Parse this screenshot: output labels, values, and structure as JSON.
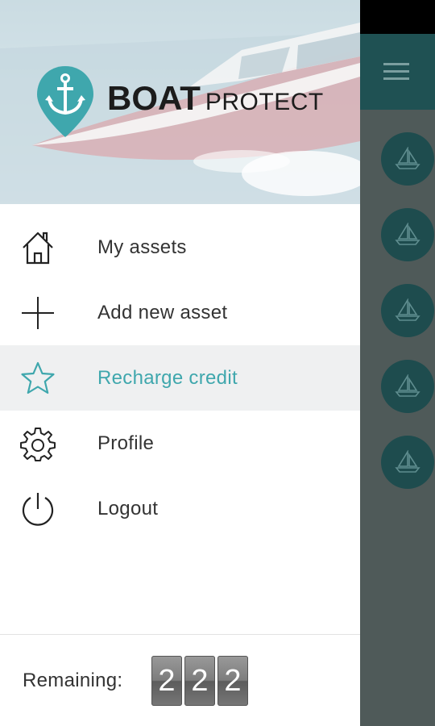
{
  "brand": {
    "word_bold": "BOAT",
    "word_light": "PROTECT"
  },
  "menu": [
    {
      "label": "My assets",
      "icon": "home-icon",
      "active": false
    },
    {
      "label": "Add new asset",
      "icon": "plus-icon",
      "active": false
    },
    {
      "label": "Recharge credit",
      "icon": "star-icon",
      "active": true
    },
    {
      "label": "Profile",
      "icon": "gear-icon",
      "active": false
    },
    {
      "label": "Logout",
      "icon": "power-icon",
      "active": false
    }
  ],
  "footer": {
    "remaining_label": "Remaining:",
    "digits": [
      "2",
      "2",
      "2"
    ]
  },
  "background_app": {
    "toolbar_icon": "hamburger-menu-icon",
    "list_icon": "sailboat-icon",
    "list_item_count": 5
  },
  "colors": {
    "accent": "#3fa7ad",
    "toolbar": "#1f5153",
    "overlay": "#4f5a59",
    "circle": "#1e4c4e"
  }
}
